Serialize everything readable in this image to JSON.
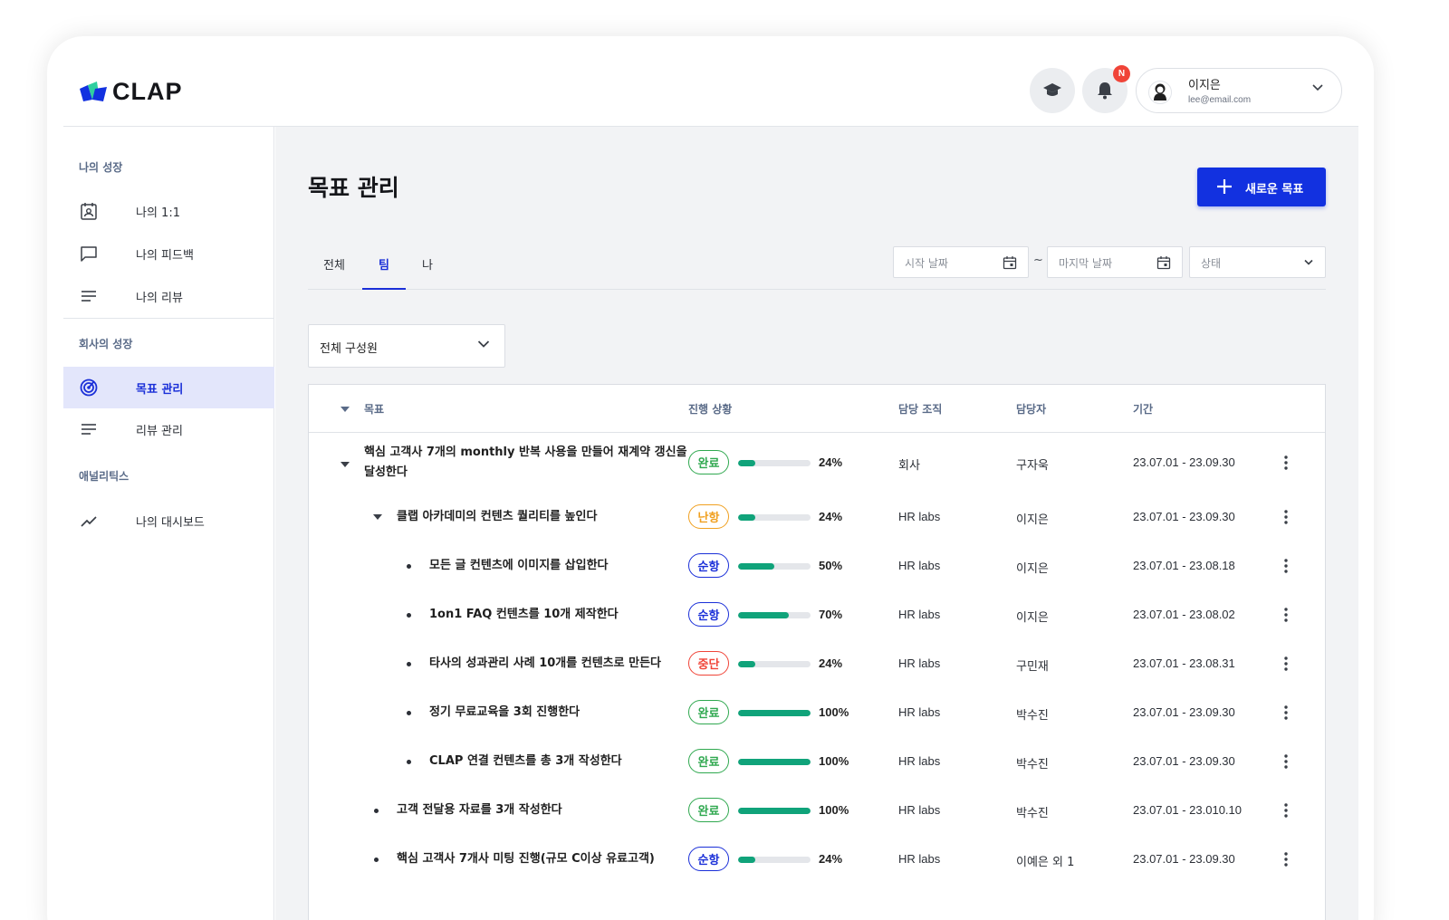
{
  "app": {
    "logo_text": "CLAP"
  },
  "header": {
    "notification_badge": "N",
    "user": {
      "name": "이지은",
      "email": "lee@email.com"
    }
  },
  "sidebar": {
    "sections": [
      {
        "title": "나의 성장",
        "items": [
          {
            "label": "나의 1:1",
            "icon": "person-card-icon"
          },
          {
            "label": "나의 피드백",
            "icon": "chat-bubble-icon"
          },
          {
            "label": "나의 리뷰",
            "icon": "lines-icon"
          }
        ]
      },
      {
        "title": "회사의 성장",
        "items": [
          {
            "label": "목표 관리",
            "icon": "target-icon",
            "active": true
          },
          {
            "label": "리뷰 관리",
            "icon": "lines-icon"
          }
        ]
      },
      {
        "title": "애널리틱스",
        "items": [
          {
            "label": "나의 대시보드",
            "icon": "trend-icon"
          }
        ]
      }
    ]
  },
  "main": {
    "title": "목표 관리",
    "new_button": "새로운 목표",
    "tabs": [
      "전체",
      "팀",
      "나"
    ],
    "active_tab": "팀",
    "filters": {
      "start_placeholder": "시작 날짜",
      "separator": "~",
      "end_placeholder": "마지막 날짜",
      "status_placeholder": "상태"
    },
    "member_select": "전체 구성원"
  },
  "table": {
    "headers": {
      "goal": "목표",
      "progress": "진행 상황",
      "org": "담당 조직",
      "owner": "담당자",
      "period": "기간"
    },
    "rows": [
      {
        "goal_line1": "핵심 고객사 7개의 monthly 반복 사용을 만들어 재계약 갱신을",
        "goal_line2": "달성한다",
        "status": "완료",
        "progress": 24,
        "pct": "24%",
        "org": "회사",
        "owner": "구자욱",
        "period": "23.07.01 - 23.09.30"
      },
      {
        "goal": "클랩 아카데미의 컨텐츠 퀄리티를 높인다",
        "status": "난항",
        "progress": 24,
        "pct": "24%",
        "org": "HR labs",
        "owner": "이지은",
        "period": "23.07.01 - 23.09.30"
      },
      {
        "goal": "모든 글 컨텐츠에 이미지를 삽입한다",
        "status": "순항",
        "progress": 50,
        "pct": "50%",
        "org": "HR labs",
        "owner": "이지은",
        "period": "23.07.01 - 23.08.18"
      },
      {
        "goal": "1on1 FAQ 컨텐츠를 10개 제작한다",
        "status": "순항",
        "progress": 70,
        "pct": "70%",
        "org": "HR labs",
        "owner": "이지은",
        "period": "23.07.01 - 23.08.02"
      },
      {
        "goal": "타사의 성과관리 사례 10개를 컨텐츠로 만든다",
        "status": "중단",
        "progress": 24,
        "pct": "24%",
        "org": "HR labs",
        "owner": "구민재",
        "period": "23.07.01 - 23.08.31"
      },
      {
        "goal": "정기 무료교육을 3회 진행한다",
        "status": "완료",
        "progress": 100,
        "pct": "100%",
        "org": "HR labs",
        "owner": "박수진",
        "period": "23.07.01 - 23.09.30"
      },
      {
        "goal": "CLAP 연결 컨텐츠를 총 3개 작성한다",
        "status": "완료",
        "progress": 100,
        "pct": "100%",
        "org": "HR labs",
        "owner": "박수진",
        "period": "23.07.01 - 23.09.30"
      },
      {
        "goal": "고객 전달용 자료를 3개 작성한다",
        "status": "완료",
        "progress": 100,
        "pct": "100%",
        "org": "HR labs",
        "owner": "박수진",
        "period": "23.07.01 - 23.010.10"
      },
      {
        "goal": "핵심 고객사 7개사 미팅 진행(규모 C이상 유료고객)",
        "status": "순항",
        "progress": 24,
        "pct": "24%",
        "org": "HR labs",
        "owner": "이예은 외 1",
        "period": "23.07.01 - 23.09.30"
      }
    ]
  },
  "colors": {
    "primary": "#1231e0",
    "progress": "#10a37a",
    "status_완료": "#2fa84f",
    "status_난항": "#f0a020",
    "status_순항": "#1a2fd8",
    "status_중단": "#f04438"
  }
}
